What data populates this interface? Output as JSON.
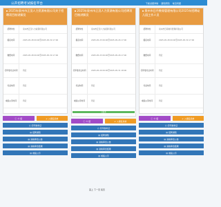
{
  "header": {
    "brand": "公开招聘考试报名平台",
    "links": [
      "下载试题详情",
      "通知须知",
      "常见问题"
    ],
    "accent": "#2d8cd3"
  },
  "columns": [
    {
      "title": "2025年泉州市正茂人力资源有限公司关于招聘项目制讲解员",
      "rows": [
        {
          "label": "招聘单位",
          "value": "泉州市正茂人力资源有限公司"
        },
        {
          "label": "报名时间",
          "value": "2025-05-28 09:00至2025-05-30 17:00"
        },
        {
          "label": "缴费时间",
          "value": "2025-05-28 09:00至2025-05-30 17:00"
        },
        {
          "label": "打印准考证时间",
          "value": "待定"
        },
        {
          "label": "考试时间",
          "value": "待定"
        },
        {
          "label": "成绩公示时间",
          "value": "待定"
        }
      ],
      "progress": null,
      "buttons": {
        "left": "介 绍",
        "right": "入报名系统",
        "print": "打印准考证",
        "info": "招聘通知",
        "notice": "资格审查公告",
        "result": "资格审查结果",
        "score": "成绩公示"
      }
    },
    {
      "title": "2025年泉州市正茂人力资源有限公司招聘项目制讲解员",
      "rows": [
        {
          "label": "招聘单位",
          "value": "泉州市正茂人力资源有限公司"
        },
        {
          "label": "报名时间",
          "value": "2025-05-23 09:00至2025-05-26 17:00"
        },
        {
          "label": "缴费时间",
          "value": "2025-05-23 09:00至2025-05-26 17:00"
        },
        {
          "label": "打印准考证时间",
          "value": "2025-05-29 09:00至2025-05-31 18:00"
        },
        {
          "label": "考试时间",
          "value": "待定"
        },
        {
          "label": "成绩公示时间",
          "value": "待定"
        }
      ],
      "progress": {
        "text": "已结束",
        "value": 100
      },
      "buttons": {
        "left": "介 绍",
        "right": "入报名系统",
        "print": "打印准考证",
        "info": "招聘通知",
        "notice": "资格审查公告",
        "result": "资格审查结果",
        "score": "成绩公示"
      }
    },
    {
      "title": "泉州市日丹教育管理有限公司2025年招聘幼儿园工作人员",
      "rows": [
        {
          "label": "招聘单位",
          "value": "泉州市日丹教育管理有限公司"
        },
        {
          "label": "报名时间",
          "value": "2025-05-28 09:00至2025-05-30 17:00"
        },
        {
          "label": "缴费时间",
          "value": "待定"
        },
        {
          "label": "打印准考证时间",
          "value": "待定"
        },
        {
          "label": "考试时间",
          "value": "待定"
        },
        {
          "label": "成绩公示时间",
          "value": "待定"
        }
      ],
      "progress": null,
      "buttons": {
        "left": "介 绍",
        "right": "入报名系统",
        "print": "打印准考证",
        "info": "招聘通知",
        "notice": "资格审查公告",
        "result": "资格审查结果",
        "score": "成绩公示"
      }
    }
  ],
  "pager": "首上 下一页 尾页"
}
